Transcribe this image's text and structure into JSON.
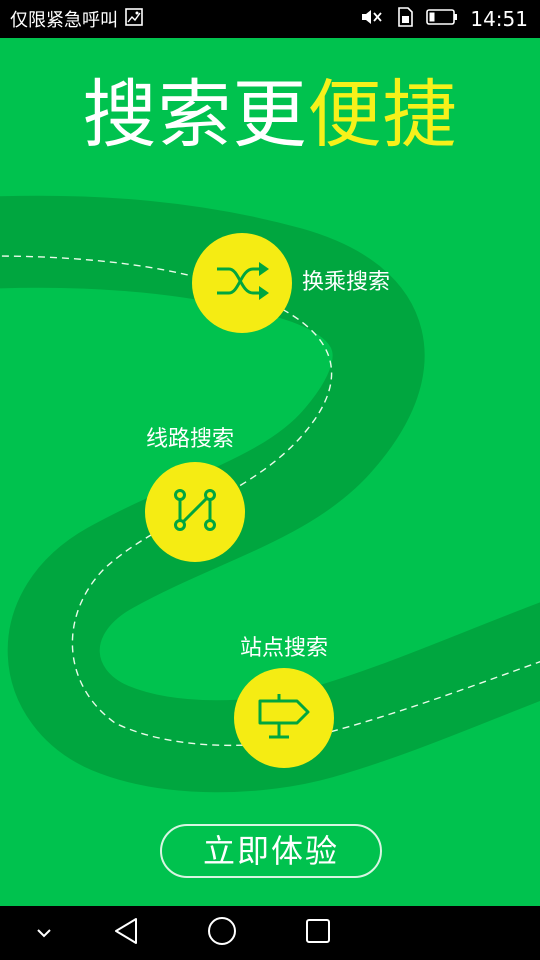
{
  "status_bar": {
    "notification_text": "仅限紧急呼叫",
    "time": "14:51",
    "icons": [
      "image-icon",
      "mute-icon",
      "sim-icon",
      "battery-icon"
    ]
  },
  "headline": {
    "part1": "搜索更",
    "part2": "便捷"
  },
  "features": [
    {
      "label": "换乘搜索",
      "icon": "shuffle-icon"
    },
    {
      "label": "线路搜索",
      "icon": "route-icon"
    },
    {
      "label": "站点搜索",
      "icon": "signpost-icon"
    }
  ],
  "cta": {
    "label": "立即体验"
  },
  "nav_bar": {
    "icons": [
      "chevron-down-icon",
      "back-icon",
      "home-icon",
      "recents-icon"
    ]
  },
  "colors": {
    "background": "#00c24e",
    "road": "#00a63f",
    "accent": "#f5ec13",
    "headline_accent": "#f6f11a"
  }
}
